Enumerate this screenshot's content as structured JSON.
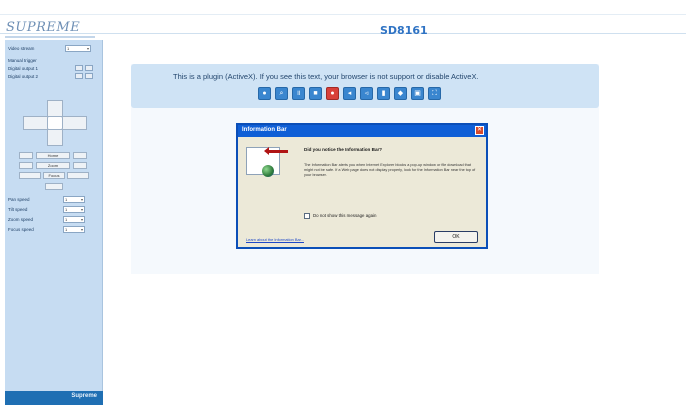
{
  "header": {
    "logo_text": "SUPREME",
    "model": "SD8161"
  },
  "sidebar": {
    "video_stream_label": "Video stream",
    "video_stream_value": "1",
    "manual_trigger_label": "Manual trigger",
    "digital_output_1_label": "Digital output 1",
    "digital_output_2_label": "Digital output 2",
    "ptz_buttons": [
      "Home",
      "Zoom",
      "Focus"
    ],
    "pan_speed_label": "Pan speed",
    "tilt_speed_label": "Tilt speed",
    "zoom_speed_label": "Zoom speed",
    "focus_speed_label": "Focus speed",
    "speed_value": "1",
    "footer_text": "Supreme"
  },
  "viewer": {
    "notice": "This is a plugin (ActiveX). If you see this text, your browser is not support or disable ActiveX.",
    "toolbar_icons": [
      "camera-icon",
      "zoom-icon",
      "pause-icon",
      "stop-icon",
      "record-icon",
      "mute-icon",
      "volume-icon",
      "talk-icon",
      "mic-icon",
      "pip-icon",
      "fullscreen-icon"
    ]
  },
  "dialog": {
    "title": "Information Bar",
    "close_glyph": "✕",
    "heading": "Did you notice the Information Bar?",
    "body": "The Information Bar alerts you when Internet Explorer blocks a pop-up window or file download that might not be safe. If a Web page does not display properly, look for the Information Bar near the top of your browser.",
    "checkbox_label": "Do not show this message again",
    "link_text": "Learn about the Information Bar...",
    "ok_label": "OK"
  },
  "colors": {
    "sidebar_bg": "#c6dcf2",
    "accent": "#2f73c4",
    "dialog_title": "#0f5fd6"
  }
}
